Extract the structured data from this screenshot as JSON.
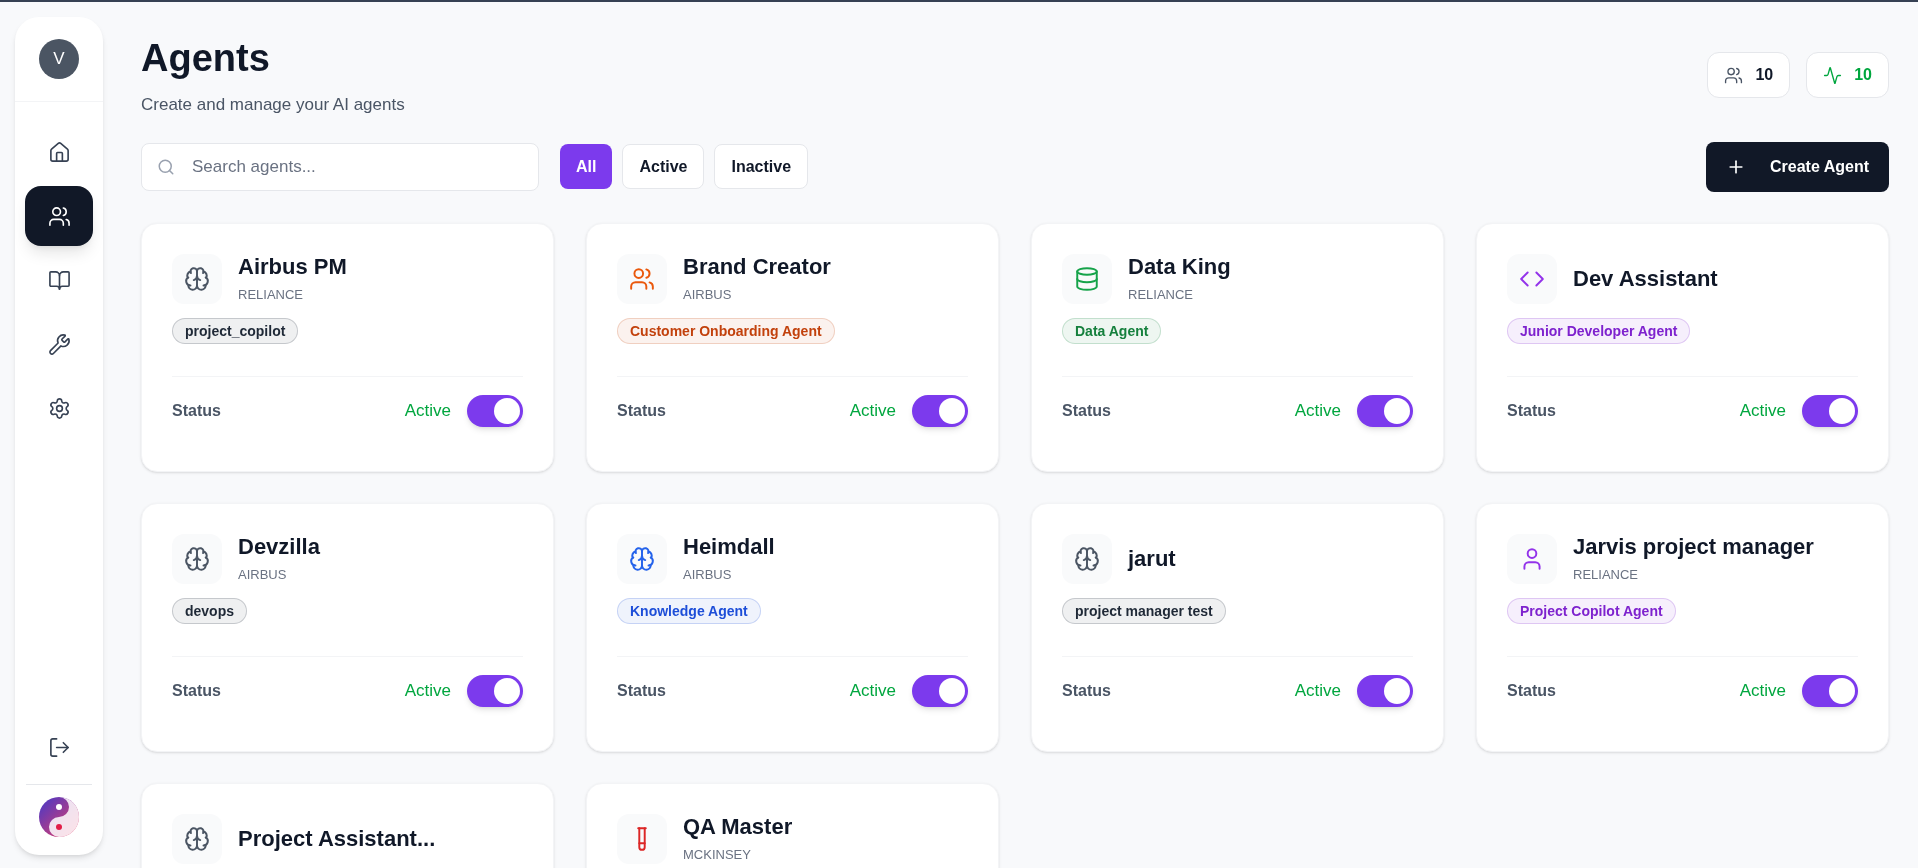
{
  "sidebar": {
    "avatar": "V",
    "items": [
      {
        "kind": "home",
        "selected": false
      },
      {
        "kind": "users",
        "selected": true
      },
      {
        "kind": "book",
        "selected": false
      },
      {
        "kind": "wrench",
        "selected": false
      },
      {
        "kind": "settings",
        "selected": false
      }
    ]
  },
  "header": {
    "title": "Agents",
    "subtitle": "Create and manage your AI agents",
    "stats": [
      {
        "kind": "users",
        "value": "10"
      },
      {
        "kind": "activity",
        "value": "10"
      }
    ]
  },
  "search": {
    "placeholder": "Search agents..."
  },
  "filters": [
    {
      "label": "All",
      "selected": true
    },
    {
      "label": "Active",
      "selected": false
    },
    {
      "label": "Inactive",
      "selected": false
    }
  ],
  "create_button": "Create Agent",
  "agents": [
    {
      "name": "Airbus PM",
      "company": "RELIANCE",
      "kind": "brain",
      "color": "#4b5563",
      "tag": {
        "text": "project_copilot",
        "color": "#1f2937"
      },
      "status_label": "Status",
      "status": "Active",
      "on": true
    },
    {
      "name": "Brand Creator",
      "company": "AIRBUS",
      "kind": "users",
      "color": "#ea580c",
      "tag": {
        "text": "Customer Onboarding Agent",
        "color": "#c2410c"
      },
      "status_label": "Status",
      "status": "Active",
      "on": true
    },
    {
      "name": "Data King",
      "company": "RELIANCE",
      "kind": "database",
      "color": "#16a34a",
      "tag": {
        "text": "Data Agent",
        "color": "#15803d"
      },
      "status_label": "Status",
      "status": "Active",
      "on": true
    },
    {
      "name": "Dev Assistant",
      "kind": "code",
      "color": "#9333ea",
      "tag": {
        "text": "Junior Developer Agent",
        "color": "#7e22ce"
      },
      "status_label": "Status",
      "status": "Active",
      "on": true
    },
    {
      "name": "Devzilla",
      "company": "AIRBUS",
      "kind": "brain",
      "color": "#4b5563",
      "tag": {
        "text": "devops",
        "color": "#1f2937"
      },
      "status_label": "Status",
      "status": "Active",
      "on": true
    },
    {
      "name": "Heimdall",
      "company": "AIRBUS",
      "kind": "brain",
      "color": "#2563eb",
      "tag": {
        "text": "Knowledge Agent",
        "color": "#1d4ed8"
      },
      "status_label": "Status",
      "status": "Active",
      "on": true
    },
    {
      "name": "jarut",
      "kind": "brain",
      "color": "#4b5563",
      "tag": {
        "text": "project manager test",
        "color": "#1f2937"
      },
      "status_label": "Status",
      "status": "Active",
      "on": true
    },
    {
      "name": "Jarvis project manager",
      "company": "RELIANCE",
      "kind": "user",
      "color": "#9333ea",
      "tag": {
        "text": "Project Copilot Agent",
        "color": "#7e22ce"
      },
      "status_label": "Status",
      "status": "Active",
      "on": true
    },
    {
      "name": "Project Assistant...",
      "kind": "brain",
      "color": "#4b5563"
    },
    {
      "name": "QA Master",
      "company": "MCKINSEY",
      "kind": "testtube",
      "color": "#dc2626"
    }
  ]
}
